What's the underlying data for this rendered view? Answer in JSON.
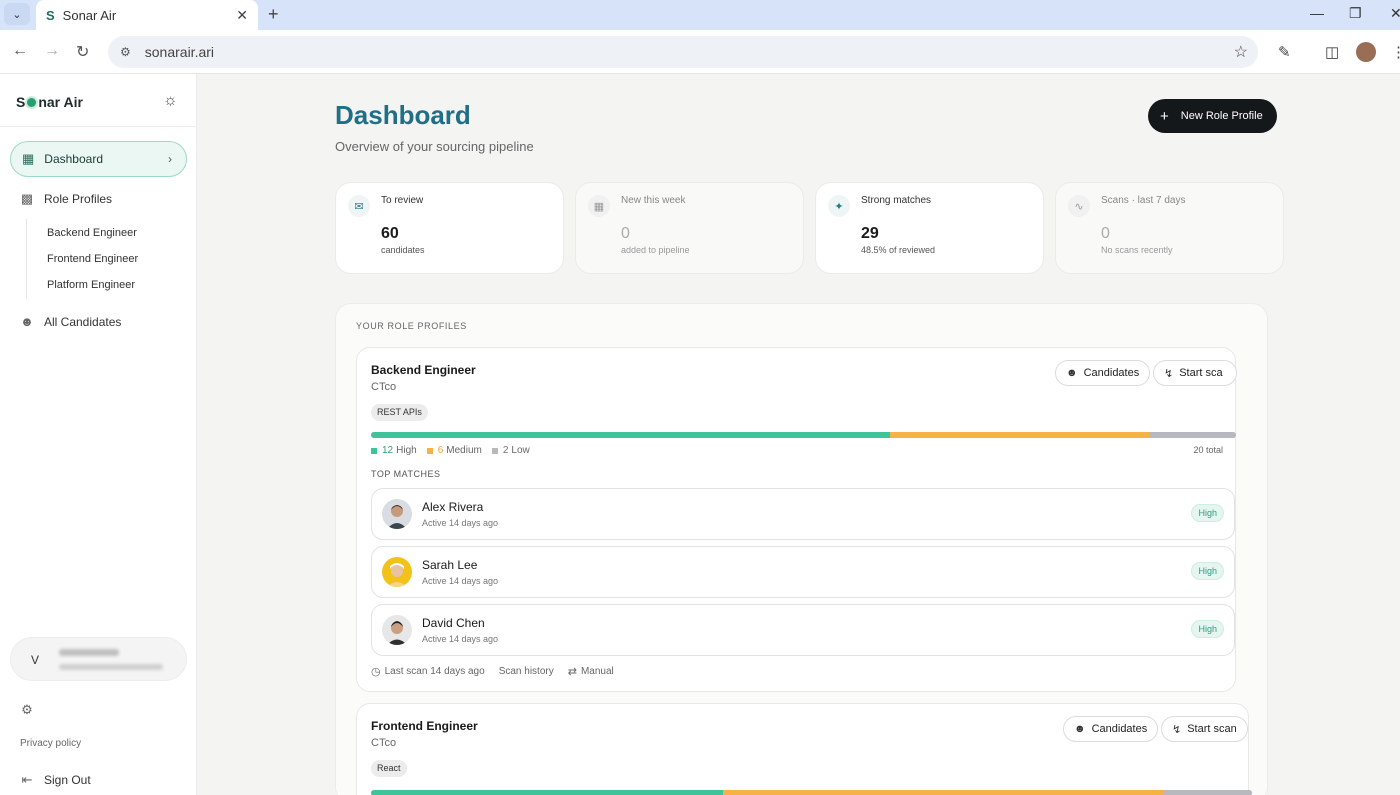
{
  "browser": {
    "tab_title": "Sonar Air",
    "tab_favicon": "S",
    "url": "sonarair.ari",
    "icons": [
      "tab-list-icon",
      "close-icon",
      "plus-icon",
      "back-icon",
      "forward-icon",
      "reload-icon",
      "site-info-icon",
      "star-icon",
      "extensions-icon",
      "sidepanel-icon",
      "more-icon"
    ]
  },
  "sidebar": {
    "brand_left": "S",
    "brand_right": "nar Air",
    "nav": {
      "dashboard": "Dashboard",
      "role_profiles": "Role Profiles",
      "sub_items": [
        "Backend Engineer",
        "Frontend Engineer",
        "Platform Engineer"
      ],
      "all_candidates": "All Candidates"
    },
    "user_initial": "V",
    "settings": "Settings",
    "privacy": "Privacy policy",
    "sign_out": "Sign Out"
  },
  "header": {
    "title": "Dashboard",
    "subtitle": "Overview of your sourcing pipeline",
    "new_role_button": "New Role Profile"
  },
  "stats": [
    {
      "label": "To review",
      "value": "60",
      "sub": "candidates"
    },
    {
      "label": "New this week",
      "value": "0",
      "sub": "added to pipeline"
    },
    {
      "label": "Strong matches",
      "value": "29",
      "sub": "48.5% of reviewed"
    },
    {
      "label": "Scans · last 7 days",
      "value": "0",
      "sub": "No scans recently"
    }
  ],
  "profiles": {
    "section_label": "YOUR ROLE PROFILES",
    "top_matches_label": "TOP MATCHES",
    "cards": [
      {
        "name": "Backend Engineer",
        "company": "CTco",
        "tag": "REST APIs",
        "candidates_button": "Candidates",
        "scan_button": "Start sca",
        "high": 12,
        "medium": 6,
        "low": 2,
        "high_label": "12",
        "high_text": "High",
        "medium_label": "6",
        "medium_text": "Medium",
        "low_label": "2",
        "low_text": "Low",
        "total": "20 total",
        "matches": [
          {
            "name": "Alex Rivera",
            "active": "Active 14 days ago",
            "badge": "High"
          },
          {
            "name": "Sarah Lee",
            "active": "Active 14 days ago",
            "badge": "High"
          },
          {
            "name": "David Chen",
            "active": "Active 14 days ago",
            "badge": "High"
          }
        ],
        "last_scan": "Last scan 14 days ago",
        "scan_history": "Scan history",
        "manual": "Manual"
      },
      {
        "name": "Frontend Engineer",
        "company": "CTco",
        "tag": "React",
        "candidates_button": "Candidates",
        "scan_button": "Start scan",
        "high_fraction": 0.4,
        "medium_fraction": 0.5
      }
    ]
  },
  "colors": {
    "accent": "#1f6f86",
    "high": "#3fc49a",
    "medium": "#f6b246",
    "low": "#b7b9bf"
  }
}
